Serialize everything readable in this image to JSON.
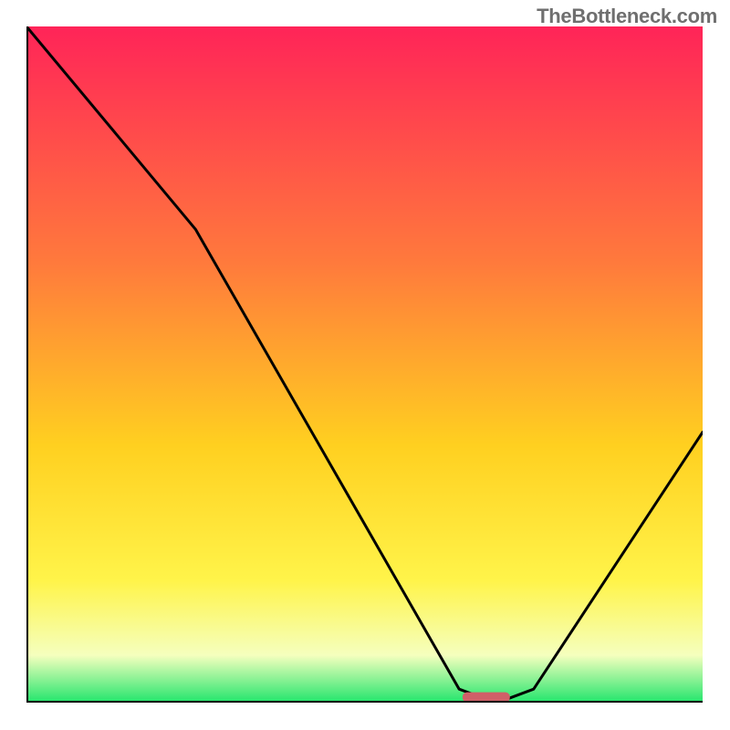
{
  "watermark": "TheBottleneck.com",
  "colors": {
    "axis": "#000000",
    "curve": "#000000",
    "gradient_top": "#ff2458",
    "gradient_mid_upper": "#ff7a3c",
    "gradient_mid": "#ffd020",
    "gradient_mid_lower": "#fff44a",
    "gradient_low": "#f5ffbe",
    "gradient_bottom": "#22e56c",
    "marker": "#d06068"
  },
  "chart_data": {
    "type": "line",
    "title": "",
    "xlabel": "",
    "ylabel": "",
    "xlim": [
      0,
      100
    ],
    "ylim": [
      0,
      100
    ],
    "x": [
      0,
      25,
      64,
      68,
      71,
      75,
      100
    ],
    "values": [
      100,
      70,
      2,
      0.5,
      0.5,
      2,
      40
    ],
    "marker": {
      "x_start": 64.5,
      "x_end": 71.5,
      "y": 0.8
    },
    "notes": "Gradient background from red (top) to green (bottom); black V-shaped curve with minimum near x≈68–71."
  }
}
